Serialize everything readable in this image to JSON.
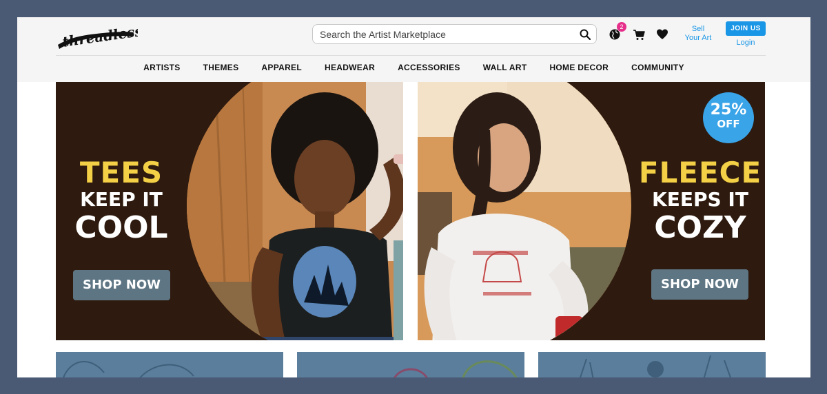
{
  "header": {
    "logo_text": "threadless",
    "search": {
      "placeholder": "Search the Artist Marketplace"
    },
    "cart_badge": "2",
    "sell_line1": "Sell",
    "sell_line2": "Your Art",
    "join_label": "JOIN US",
    "login_label": "Login"
  },
  "nav": {
    "items": [
      "ARTISTS",
      "THEMES",
      "APPAREL",
      "HEADWEAR",
      "ACCESSORIES",
      "WALL ART",
      "HOME DECOR",
      "COMMUNITY"
    ]
  },
  "banners": [
    {
      "line1": "TEES",
      "line2": "KEEP IT",
      "line3": "COOL",
      "button": "SHOP NOW"
    },
    {
      "line1": "FLEECE",
      "line2": "KEEPS IT",
      "line3": "COZY",
      "button": "SHOP NOW",
      "promo_value": "25%",
      "promo_label": "OFF"
    }
  ],
  "colors": {
    "accent": "#1a96e6",
    "banner_bg": "#2e1a0e",
    "headline_yellow": "#f3d046",
    "shop_button": "#5e7684",
    "badge": "#e62f8b",
    "promo": "#3aa4e8"
  }
}
